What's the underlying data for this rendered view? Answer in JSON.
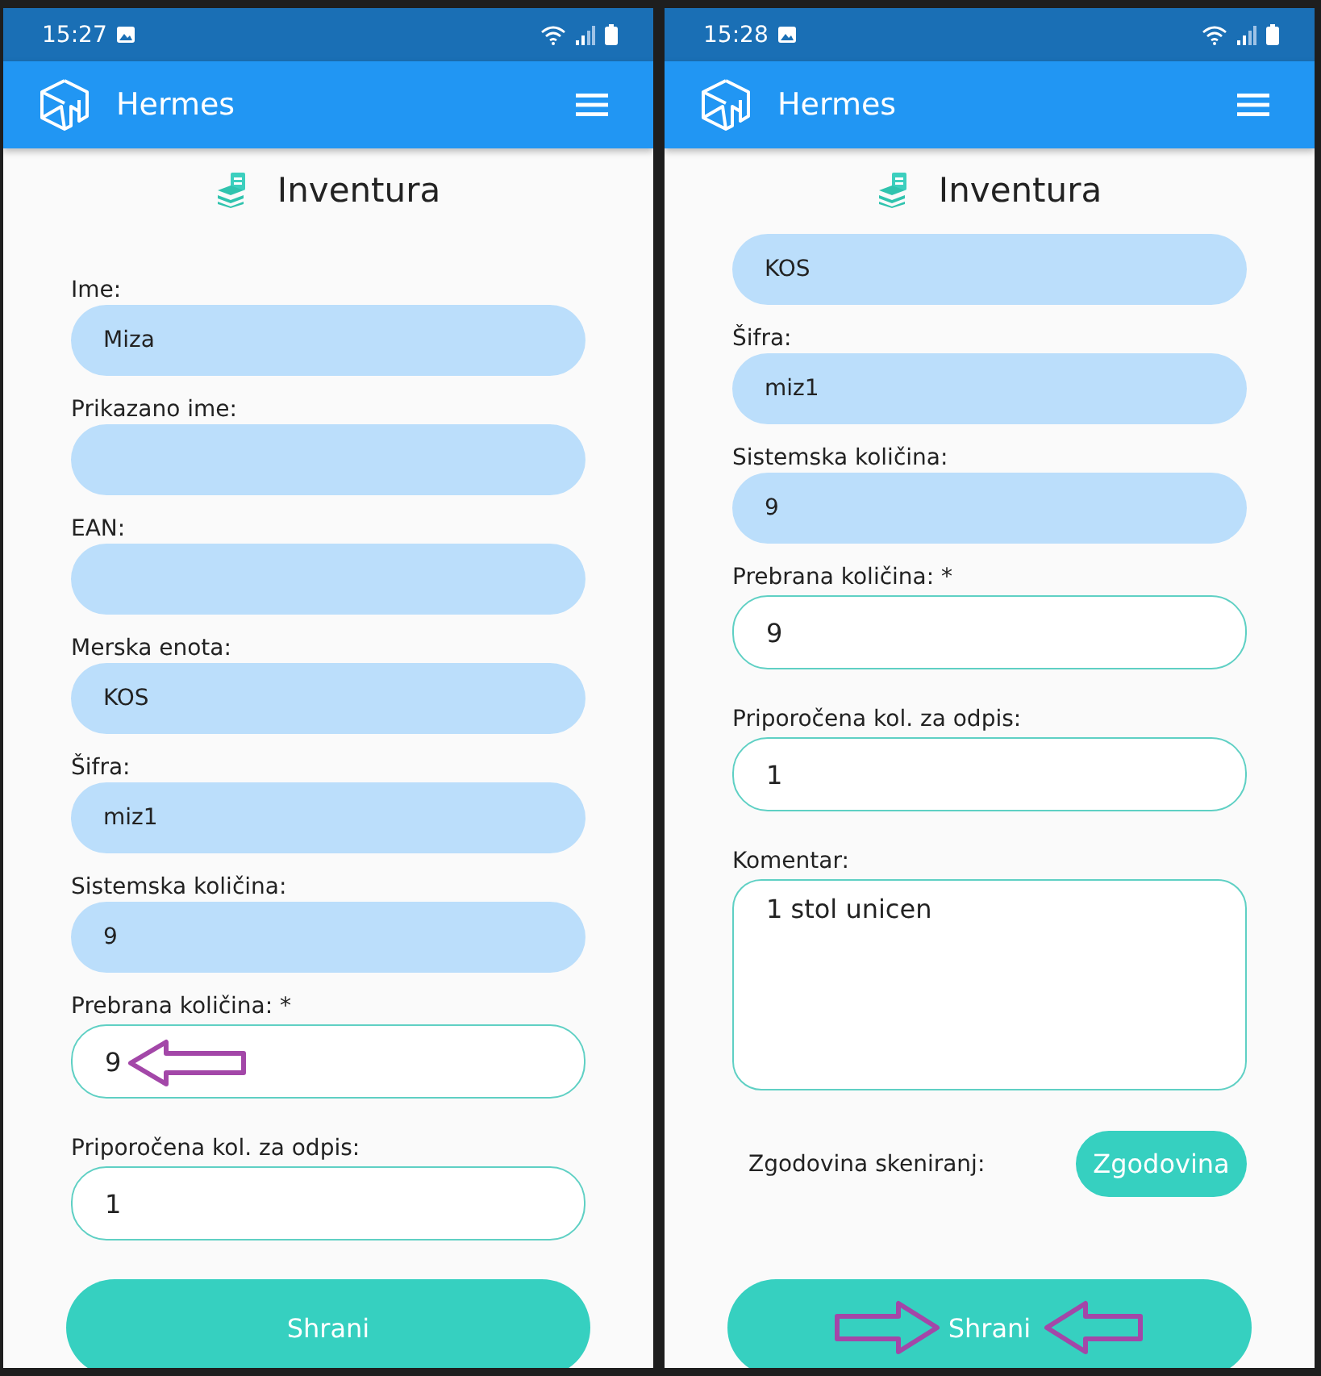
{
  "screens": [
    {
      "status_bar": {
        "time": "15:27"
      },
      "app_bar": {
        "title": "Hermes"
      },
      "page_title": "Inventura",
      "fields": [
        {
          "label": "Ime:",
          "value": "Miza",
          "kind": "readonly"
        },
        {
          "label": "Prikazano ime:",
          "kind": "readonly"
        },
        {
          "label": "EAN:",
          "kind": "readonly"
        },
        {
          "label": "Merska enota:",
          "value": "KOS",
          "kind": "readonly"
        },
        {
          "label": "Šifra:",
          "value": "miz1",
          "kind": "readonly"
        },
        {
          "label": "Sistemska količina:",
          "value": "9",
          "kind": "readonly"
        },
        {
          "label": "Prebrana količina: *",
          "value": "9",
          "kind": "editable",
          "annotation_arrow": true
        },
        {
          "label": "Priporočena kol. za odpis:",
          "value": "1",
          "kind": "editable"
        }
      ],
      "save_button": {
        "label": "Shrani"
      }
    },
    {
      "status_bar": {
        "time": "15:28"
      },
      "app_bar": {
        "title": "Hermes"
      },
      "page_title": "Inventura",
      "fields": [
        {
          "value": "KOS",
          "kind": "readonly"
        },
        {
          "label": "Šifra:",
          "value": "miz1",
          "kind": "readonly"
        },
        {
          "label": "Sistemska količina:",
          "value": "9",
          "kind": "readonly"
        },
        {
          "label": "Prebrana količina: *",
          "value": "9",
          "kind": "editable"
        },
        {
          "label": "Priporočena kol. za odpis:",
          "value": "1",
          "kind": "editable"
        },
        {
          "label": "Komentar:",
          "value": "1 stol unicen",
          "kind": "multiline"
        }
      ],
      "history": {
        "label": "Zgodovina skeniranj:",
        "button": "Zgodovina"
      },
      "save_button": {
        "label": "Shrani",
        "annotation_arrows": true
      }
    }
  ]
}
